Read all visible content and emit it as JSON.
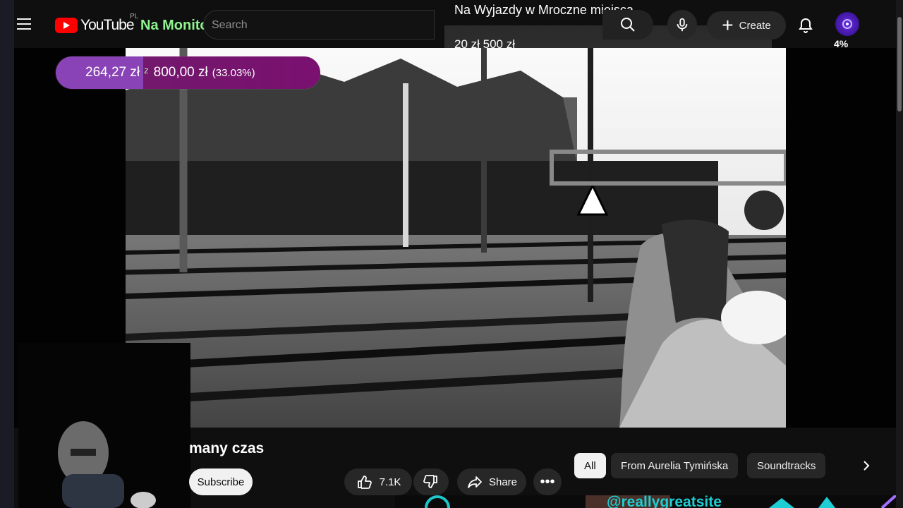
{
  "header": {
    "brand": "YouTube",
    "region": "PL",
    "channel": "Na Monitor",
    "search_placeholder": "Search",
    "create_label": "Create",
    "goal_title": "Na Wyjazdy w Mroczne miejsca",
    "goal_amount": "20 zł 500 zł",
    "percent": "4%"
  },
  "donation": {
    "current": "264,27 zł",
    "separator": "z",
    "target": "800,00 zł",
    "progress": "(33.03%)"
  },
  "video": {
    "title_fragment": "many czas"
  },
  "actions": {
    "subscribe": "Subscribe",
    "likes": "7.1K",
    "share": "Share"
  },
  "chips": [
    "All",
    "From Aurelia Tymińska",
    "Soundtracks"
  ],
  "watermark": "@reallygreatsite",
  "icons": {
    "menu": "hamburger-menu-icon",
    "search": "search-icon",
    "mic": "microphone-icon",
    "bell": "bell-icon",
    "like": "thumbs-up-icon",
    "dislike": "thumbs-down-icon",
    "share": "share-arrow-icon",
    "more": "more-horizontal-icon",
    "next": "chevron-right-icon"
  }
}
